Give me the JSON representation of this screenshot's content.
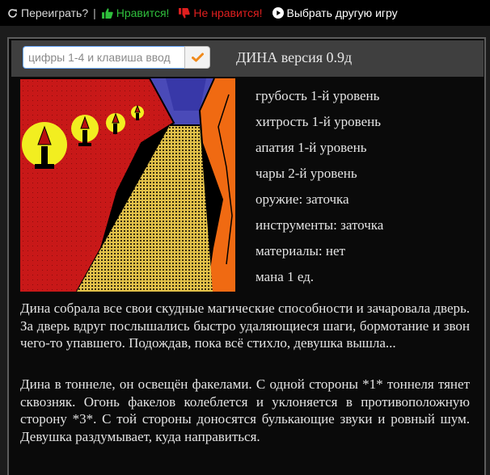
{
  "toolbar": {
    "replay_label": "Переиграть?",
    "separator": "|",
    "like_label": "Нравится!",
    "dislike_label": "Не нравится!",
    "other_game_label": "Выбрать другую игру",
    "colors": {
      "like": "#2fbf3c",
      "dislike": "#e01f1f"
    },
    "icons": [
      "refresh-icon",
      "thumbs-up-icon",
      "thumbs-down-icon",
      "play-circle-icon"
    ]
  },
  "command": {
    "placeholder": "цифры 1-4 и клавиша ввод",
    "value": "",
    "submit_icon": "checkmark-icon",
    "submit_color": "#f08a1c"
  },
  "game": {
    "title": "ДИНА версия 0.9д"
  },
  "stats": [
    "грубость 1-й уровень",
    "хитрость 1-й уровень",
    "апатия 1-й уровень",
    "чары 2-й уровень",
    "оружие: заточка",
    "инструменты: заточка",
    "материалы: нет",
    "мана 1 ед."
  ],
  "story": {
    "paragraph_1": "Дина собрала все свои скудные магические способности и зачаровала дверь. За дверь вдруг послышались быстро удаляющиеся шаги, бормотание и звон чего-то упавшего. Подождав, пока всё стихло, девушка вышла...",
    "paragraph_2": "Дина в тоннеле, он освещён факелами. С одной стороны *1* тоннеля тянет сквозняк. Огонь факелов колеблется и уклоняется в противоположную сторону *3*. С той стороны доносятся булькающие звуки и ровный шум. Девушка раздумывает, куда направиться."
  }
}
